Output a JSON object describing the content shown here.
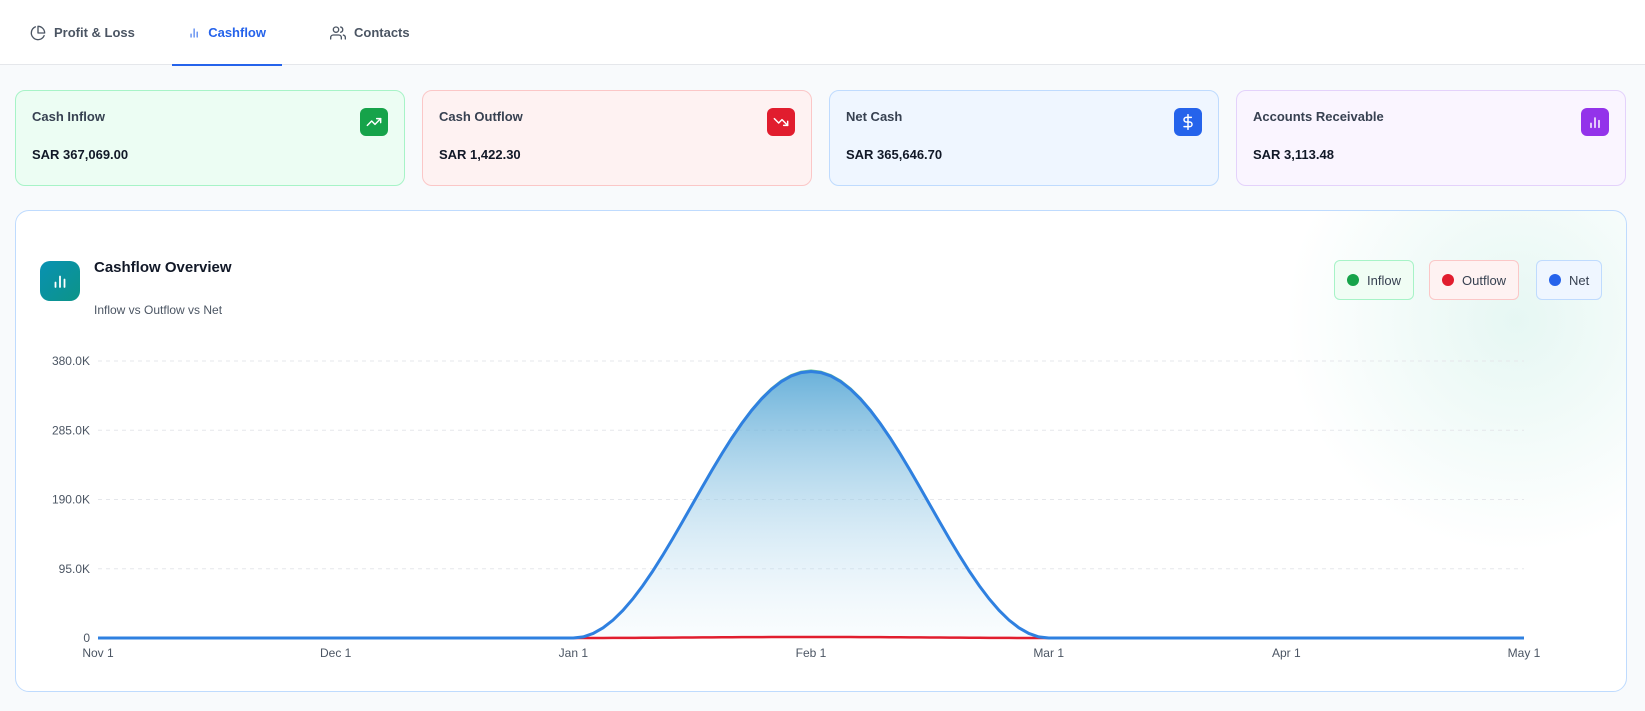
{
  "tabs": [
    {
      "label": "Profit & Loss",
      "icon": "pie-chart-icon",
      "active": false
    },
    {
      "label": "Cashflow",
      "icon": "bar-chart-icon",
      "active": true
    },
    {
      "label": "Contacts",
      "icon": "users-icon",
      "active": false
    }
  ],
  "kpis": [
    {
      "label": "Cash Inflow",
      "value": "SAR 367,069.00",
      "icon": "trending-up-icon",
      "color": "#16a34a"
    },
    {
      "label": "Cash Outflow",
      "value": "SAR 1,422.30",
      "icon": "trending-down-icon",
      "color": "#e11d2e"
    },
    {
      "label": "Net Cash",
      "value": "SAR 365,646.70",
      "icon": "dollar-icon",
      "color": "#2563eb"
    },
    {
      "label": "Accounts Receivable",
      "value": "SAR 3,113.48",
      "icon": "bar-chart-icon",
      "color": "#9333ea"
    }
  ],
  "chart_card": {
    "title": "Cashflow Overview",
    "subtitle": "Inflow vs Outflow vs Net",
    "legend": [
      {
        "label": "Inflow",
        "color": "#16a34a"
      },
      {
        "label": "Outflow",
        "color": "#e11d2e"
      },
      {
        "label": "Net",
        "color": "#2563eb"
      }
    ]
  },
  "chart_data": {
    "type": "area",
    "x": [
      "Nov 1",
      "Dec 1",
      "Jan 1",
      "Feb 1",
      "Mar 1",
      "Apr 1",
      "May 1"
    ],
    "series": [
      {
        "name": "Inflow",
        "color": "#16a34a",
        "values": [
          0,
          0,
          0,
          367069,
          0,
          0,
          0
        ]
      },
      {
        "name": "Outflow",
        "color": "#e11d2e",
        "values": [
          0,
          0,
          0,
          1422.3,
          0,
          0,
          0
        ]
      },
      {
        "name": "Net",
        "color": "#2563eb",
        "values": [
          0,
          0,
          0,
          365646.7,
          0,
          0,
          0
        ]
      }
    ],
    "yticks": [
      "0",
      "95.0K",
      "190.0K",
      "285.0K",
      "380.0K"
    ],
    "ylim": [
      0,
      380000
    ],
    "grid": true,
    "legend_position": "top-right"
  }
}
